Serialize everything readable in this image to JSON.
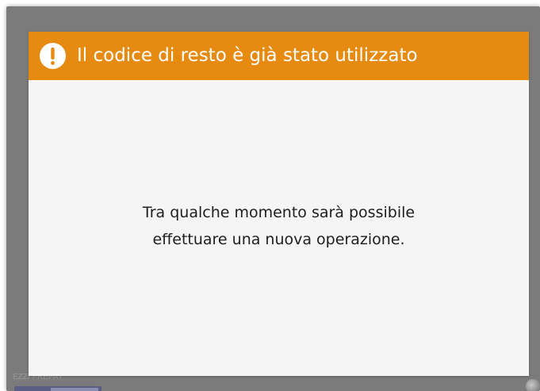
{
  "background": {
    "footer_label": "EZZI PREPAY"
  },
  "dialog": {
    "icon": "exclamation-icon",
    "title": "Il codice di resto è già stato utilizzato",
    "message_line_1": "Tra qualche momento sarà possibile",
    "message_line_2": "effettuare una nuova operazione.",
    "header_color": "#e78a10",
    "body_color": "#f5f5f5"
  }
}
